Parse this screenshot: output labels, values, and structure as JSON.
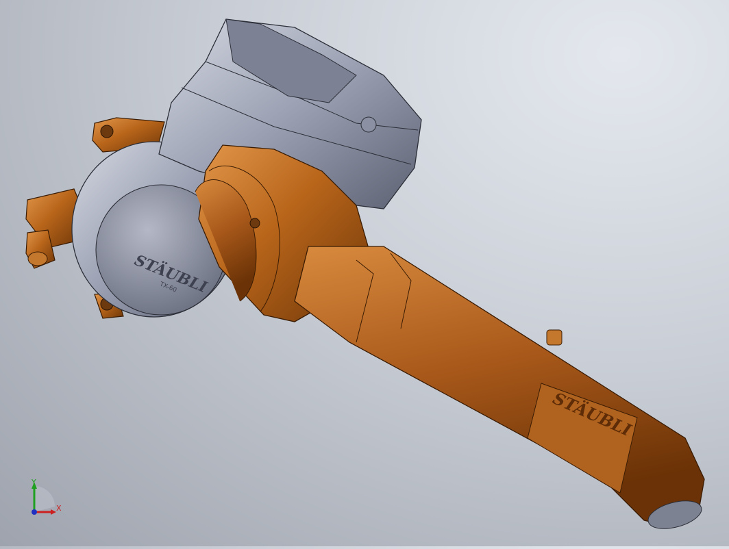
{
  "viewport": {
    "background_top": "#e4e8ee",
    "background_bottom": "#9ea3ad"
  },
  "model": {
    "orange": "#b8651a",
    "orange_dark": "#6e3608",
    "orange_light": "#e2974a",
    "gray": "#9aa0b2",
    "gray_dark": "#5c6172",
    "gray_light": "#d6d9e3"
  },
  "logos": {
    "base_logo": "STÄUBLI",
    "base_sub": "TX-60",
    "forearm_logo": "STÄUBLI"
  },
  "triad": {
    "x_label": "X",
    "y_label": "Y",
    "x_color": "#cc2020",
    "y_color": "#20a020",
    "z_color": "#2030c0"
  }
}
